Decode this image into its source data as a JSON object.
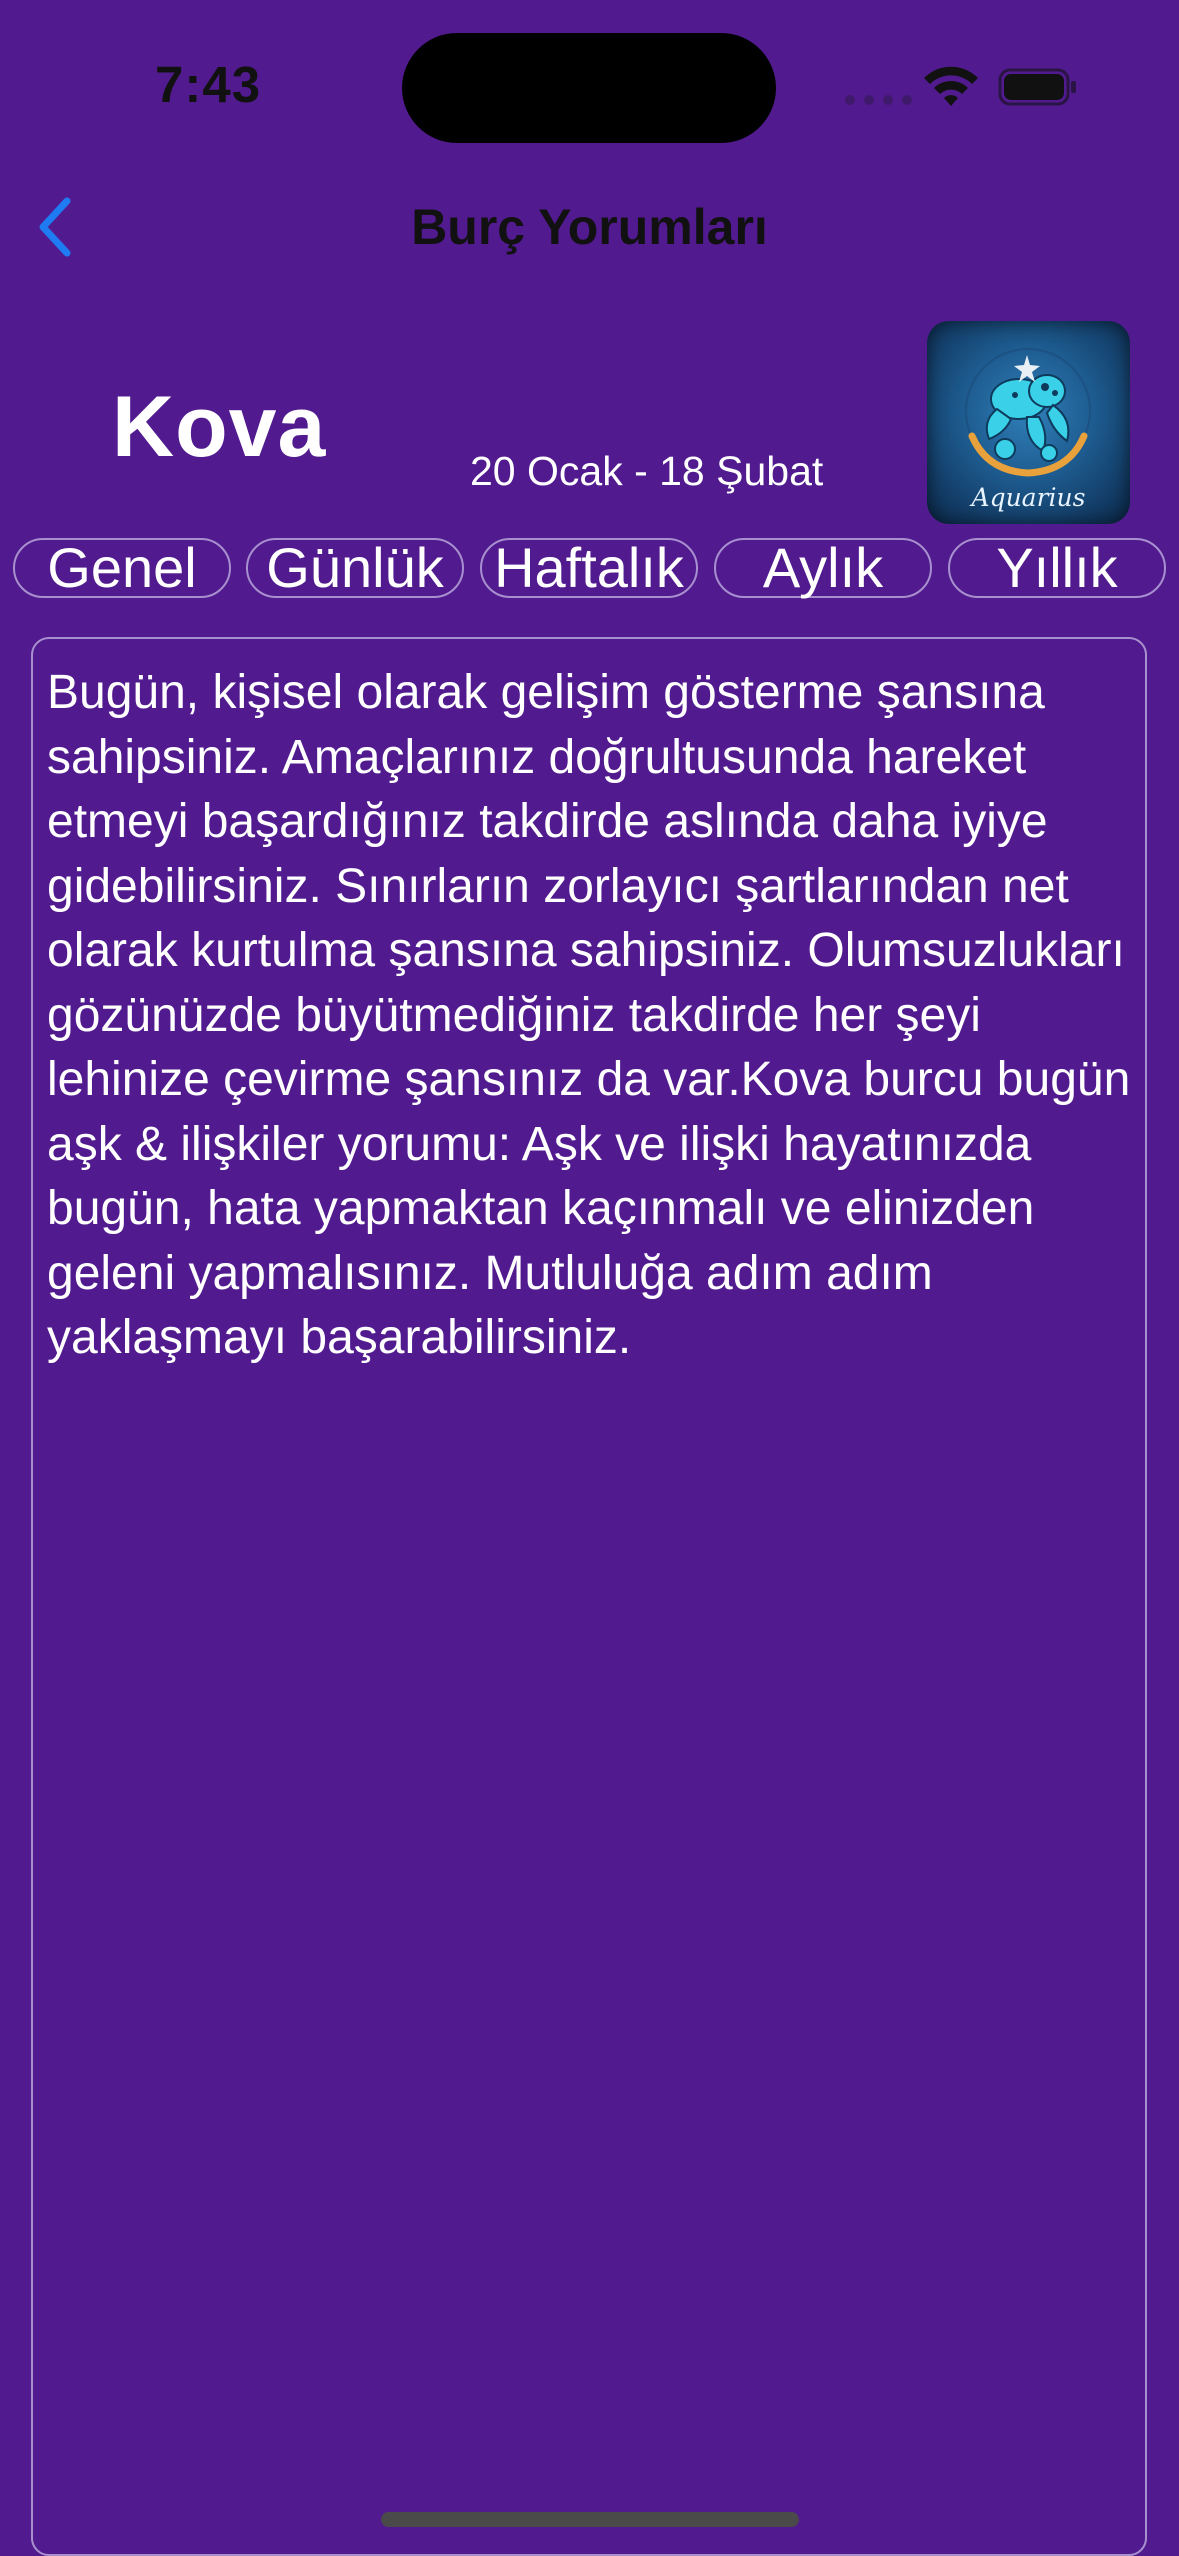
{
  "status_bar": {
    "time": "7:43"
  },
  "nav": {
    "title": "Burç Yorumları",
    "back_icon": "chevron-left-icon"
  },
  "header": {
    "sign_name": "Kova",
    "date_range": "20 Ocak - 18 Şubat",
    "image_caption": "Aquarius"
  },
  "tabs": [
    {
      "label": "Genel"
    },
    {
      "label": "Günlük"
    },
    {
      "label": "Haftalık"
    },
    {
      "label": "Aylık"
    },
    {
      "label": "Yıllık"
    }
  ],
  "content": {
    "text": "Bugün, kişisel olarak gelişim gösterme şansına sahipsiniz. Amaçlarınız doğrultusunda hareket etmeyi başardığınız takdirde aslında daha iyiye gidebilirsiniz. Sınırların zorlayıcı şartlarından net olarak kurtulma şansına sahipsiniz. Olumsuzlukları gözünüzde büyütmediğiniz takdirde her şeyi lehinize çevirme şansınız da var.Kova burcu bugün aşk & ilişkiler yorumu: Aşk ve ilişki hayatınızda bugün, hata yapmaktan kaçınmalı ve elinizden geleni yapmalısınız. Mutluluğa adım adım yaklaşmayı başarabilirsiniz."
  },
  "colors": {
    "background": "#511B8F",
    "accent_blue": "#1E7BF2",
    "border": "#A890CF",
    "text": "#FFFFFF"
  }
}
